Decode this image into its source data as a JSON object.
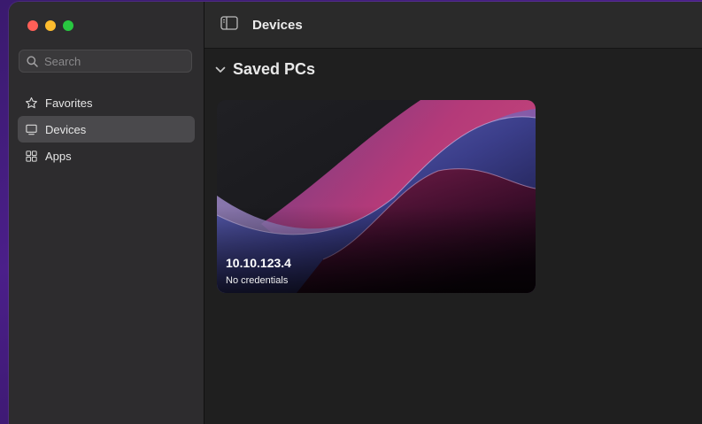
{
  "window": {
    "traffic_lights": [
      "close",
      "minimize",
      "zoom"
    ]
  },
  "sidebar": {
    "search_placeholder": "Search",
    "items": [
      {
        "label": "Favorites",
        "icon": "star-icon",
        "active": false
      },
      {
        "label": "Devices",
        "icon": "monitor-icon",
        "active": true
      },
      {
        "label": "Apps",
        "icon": "apps-icon",
        "active": false
      }
    ]
  },
  "toolbar": {
    "title": "Devices",
    "sidebar_toggle_icon": "sidebar-toggle-icon"
  },
  "main": {
    "section_title": "Saved PCs",
    "section_chevron": "chevron-down-icon",
    "pcs": [
      {
        "host": "10.10.123.4",
        "credentials": "No credentials"
      }
    ]
  },
  "colors": {
    "sidebar_bg": "#2d2c2e",
    "main_bg": "#1f1f1f",
    "toolbar_bg": "#2a2a2a",
    "active_item_bg": "#4a494c",
    "close": "#fe5f57",
    "minimize": "#febc2e",
    "zoom": "#28c840"
  }
}
